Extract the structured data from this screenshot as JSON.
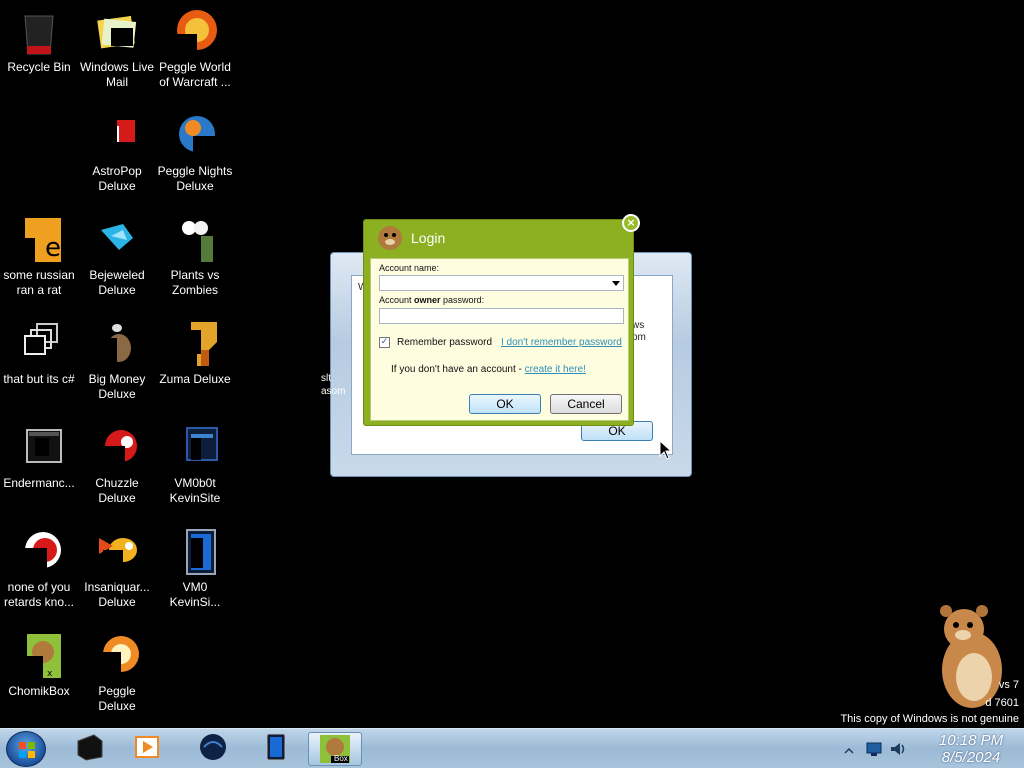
{
  "desktop": {
    "icons": [
      {
        "label": "Recycle Bin",
        "icon": "recycle-bin-icon"
      },
      {
        "label": "Windows Live Mail",
        "icon": "windows-live-mail-icon"
      },
      {
        "label": "Peggle World of Warcraft ...",
        "icon": "peggle-wow-icon"
      },
      {
        "label": "AstroPop Deluxe",
        "icon": "astropop-icon"
      },
      {
        "label": "Peggle Nights Deluxe",
        "icon": "peggle-nights-icon"
      },
      {
        "label": "some russian ran a rat",
        "icon": "russian-rat-icon"
      },
      {
        "label": "Bejeweled Deluxe",
        "icon": "bejeweled-icon"
      },
      {
        "label": "Plants vs Zombies",
        "icon": "plants-vs-zombies-icon"
      },
      {
        "label": "that but its c#",
        "icon": "folder-stack-icon"
      },
      {
        "label": "Big Money Deluxe",
        "icon": "big-money-icon"
      },
      {
        "label": "Zuma Deluxe",
        "icon": "zuma-icon"
      },
      {
        "label": "Endermanc...",
        "icon": "endermanc-icon"
      },
      {
        "label": "Chuzzle Deluxe",
        "icon": "chuzzle-icon"
      },
      {
        "label": "VM0b0t KevinSite",
        "icon": "vmbot-icon"
      },
      {
        "label": "none of you retards kno...",
        "icon": "none-of-you-icon"
      },
      {
        "label": "Insaniquar... Deluxe",
        "icon": "insaniquarium-icon"
      },
      {
        "label": "VM0 KevinSi...",
        "icon": "vm0-icon"
      },
      {
        "label": "ChomikBox",
        "icon": "chomikbox-icon"
      },
      {
        "label": "Peggle Deluxe",
        "icon": "peggle-deluxe-icon"
      }
    ]
  },
  "background_window": {
    "ok_label": "OK",
    "frag_1": "W",
    "frag_2": "ws",
    "frag_3": "om",
    "frag_4": "slt",
    "frag_5": "asom"
  },
  "login": {
    "title": "Login",
    "account_name_label": "Account name:",
    "password_label_prefix": "Account ",
    "password_label_bold": "owner",
    "password_label_suffix": " password:",
    "account_name_value": "",
    "password_value": "",
    "remember_label": "Remember password",
    "forgot_link": "I don't remember password",
    "no_account_text": "If you don't have an account - ",
    "create_link": "create it here!",
    "ok_label": "OK",
    "cancel_label": "Cancel",
    "close_glyph": "×"
  },
  "watermark": {
    "line1": "vs 7",
    "line2": "d 7601",
    "line3": "This copy of Windows is not genuine"
  },
  "taskbar": {
    "time": "10:18 PM",
    "date": "8/5/2024",
    "pinned": [
      {
        "icon": "windows-start-icon"
      },
      {
        "icon": "black-box-app-icon"
      },
      {
        "icon": "media-player-icon"
      },
      {
        "icon": "dark-sphere-app-icon"
      },
      {
        "icon": "blue-device-app-icon"
      },
      {
        "icon": "chomikbox-taskbar-icon"
      }
    ],
    "chomik_box_text": "Box"
  },
  "colors": {
    "login_frame": "#8cb021",
    "login_body": "#fffde0",
    "link": "#2e8fb8",
    "taskbar": "#a8c4dc"
  }
}
